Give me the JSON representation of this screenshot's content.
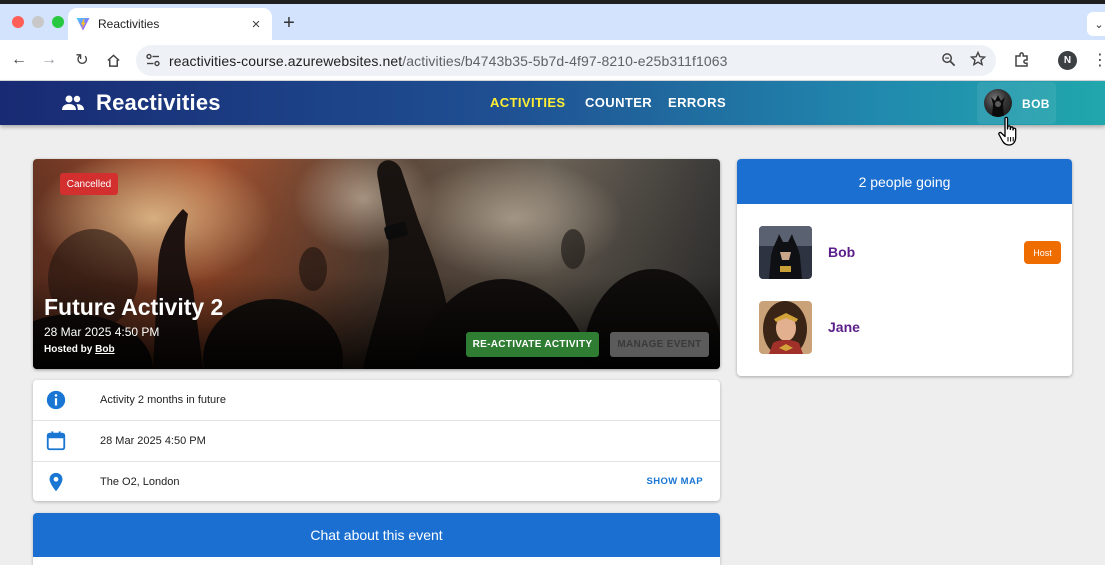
{
  "browser": {
    "tab_title": "Reactivities",
    "url_host": "reactivities-course.azurewebsites.net",
    "url_path": "/activities/b4743b35-5b7d-4f97-8210-e25b311f1063",
    "profile_initial": "N"
  },
  "nav": {
    "brand": "Reactivities",
    "items": [
      {
        "label": "ACTIVITIES",
        "active": true
      },
      {
        "label": "COUNTER",
        "active": false
      },
      {
        "label": "ERRORS",
        "active": false
      }
    ],
    "user_name": "BOB"
  },
  "activity": {
    "status_badge": "Cancelled",
    "title": "Future Activity 2",
    "date": "28 Mar 2025 4:50 PM",
    "hosted_by_label": "Hosted by",
    "host": "Bob",
    "reactivate_label": "RE-ACTIVATE ACTIVITY",
    "manage_label": "MANAGE EVENT"
  },
  "details": {
    "description": "Activity 2 months in future",
    "date": "28 Mar 2025 4:50 PM",
    "venue": "The O2, London",
    "show_map_label": "SHOW MAP"
  },
  "chat": {
    "title": "Chat about this event"
  },
  "attendees": {
    "header": "2 people going",
    "people": [
      {
        "name": "Bob",
        "badge": "Host"
      },
      {
        "name": "Jane",
        "badge": ""
      }
    ]
  },
  "colors": {
    "primary": "#1a6fd0",
    "cancelled": "#d32f2f",
    "reactivate": "#2e7d32",
    "host_badge": "#ef6c00",
    "attendee_name": "#5a1f8a",
    "active_nav": "#ffee33"
  }
}
